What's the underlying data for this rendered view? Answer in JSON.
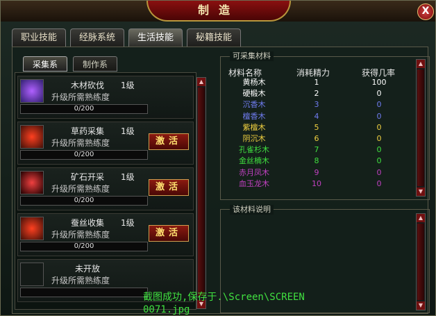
{
  "window": {
    "title": "制造",
    "close_label": "X"
  },
  "tabs": [
    {
      "label": "职业技能"
    },
    {
      "label": "经脉系统"
    },
    {
      "label": "生活技能"
    },
    {
      "label": "秘籍技能"
    }
  ],
  "active_tab": "生活技能",
  "subtabs": [
    {
      "label": "采集系"
    },
    {
      "label": "制作系"
    }
  ],
  "skills": [
    {
      "name": "木材砍伐",
      "level": "1级",
      "req": "升级所需熟练度",
      "progress": "0/200",
      "button": ""
    },
    {
      "name": "草药采集",
      "level": "1级",
      "req": "升级所需熟练度",
      "progress": "0/200",
      "button": "激活"
    },
    {
      "name": "矿石开采",
      "level": "1级",
      "req": "升级所需熟练度",
      "progress": "0/200",
      "button": "激活"
    },
    {
      "name": "蚕丝收集",
      "level": "1级",
      "req": "升级所需熟练度",
      "progress": "0/200",
      "button": "激活"
    },
    {
      "name": "未开放",
      "level": "",
      "req": "升级所需熟练度",
      "progress": "",
      "button": ""
    }
  ],
  "materials": {
    "title": "可采集材料",
    "headers": [
      "材料名称",
      "消耗精力",
      "获得几率"
    ],
    "rows": [
      {
        "name": "黄杨木",
        "cost": "1",
        "rate": "100",
        "color": "#ffffff"
      },
      {
        "name": "硬椴木",
        "cost": "2",
        "rate": "0",
        "color": "#ffffff"
      },
      {
        "name": "沉香木",
        "cost": "3",
        "rate": "0",
        "color": "#6f7cf0"
      },
      {
        "name": "檀香木",
        "cost": "4",
        "rate": "0",
        "color": "#6f7cf0"
      },
      {
        "name": "紫檀木",
        "cost": "5",
        "rate": "0",
        "color": "#f0d040"
      },
      {
        "name": "阴沉木",
        "cost": "6",
        "rate": "0",
        "color": "#f0d040"
      },
      {
        "name": "孔雀杉木",
        "cost": "7",
        "rate": "0",
        "color": "#40e040"
      },
      {
        "name": "金丝楠木",
        "cost": "8",
        "rate": "0",
        "color": "#40e040"
      },
      {
        "name": "赤月凤木",
        "cost": "9",
        "rate": "0",
        "color": "#c040c0"
      },
      {
        "name": "血玉龙木",
        "cost": "10",
        "rate": "0",
        "color": "#c040c0"
      }
    ]
  },
  "description": {
    "title": "该材料说明",
    "text": ""
  },
  "screenshot_note": {
    "line1": "截图成功,保存于.\\Screen\\SCREEN",
    "line2": "0071.jpg"
  }
}
